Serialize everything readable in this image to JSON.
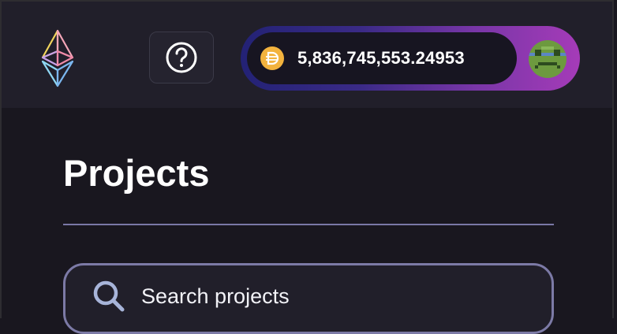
{
  "header": {
    "logo_icon": "ethereum-logo-icon",
    "help_icon": "question-circle-icon",
    "wallet": {
      "token_icon": "dai-token-icon",
      "balance": "5,836,745,553.24953",
      "avatar_icon": "pixel-avatar-icon"
    }
  },
  "main": {
    "title": "Projects",
    "search": {
      "icon": "search-icon",
      "placeholder": "Search projects",
      "value": ""
    }
  },
  "colors": {
    "background": "#19171f",
    "header_bg": "#211f2a",
    "accent_gradient_start": "#232275",
    "accent_gradient_end": "#a53bb8",
    "dai_yellow": "#f3b33e",
    "divider": "#7a78a6"
  }
}
